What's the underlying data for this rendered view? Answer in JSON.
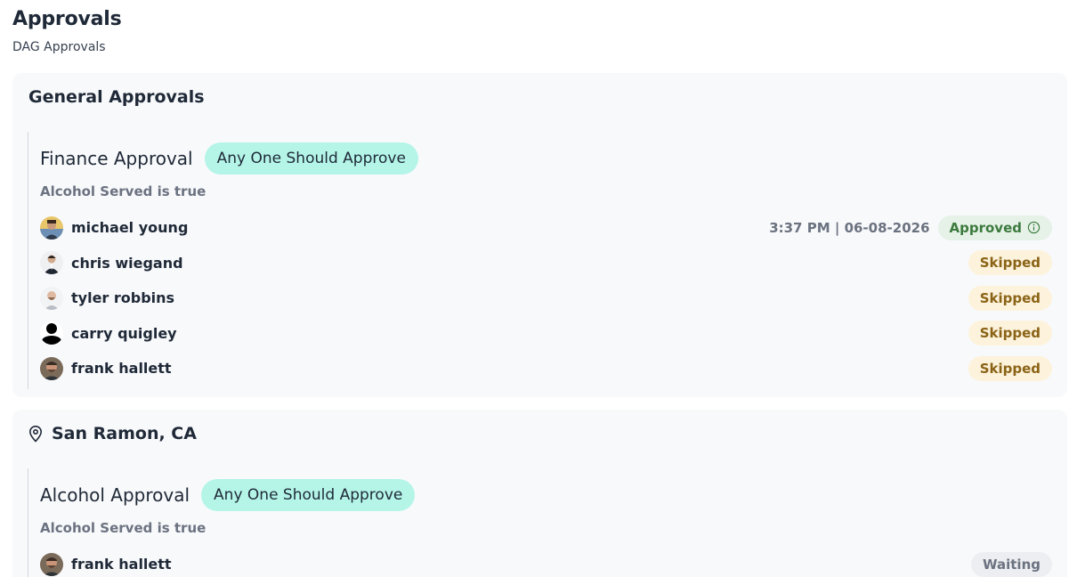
{
  "page": {
    "title": "Approvals",
    "subtitle": "DAG Approvals"
  },
  "sections": [
    {
      "title": "General Approvals",
      "icon": null,
      "groups": [
        {
          "title": "Finance Approval",
          "rule": "Any One Should Approve",
          "condition": "Alcohol Served is true",
          "approvers": [
            {
              "name": "michael young",
              "timestamp": "3:37 PM | 06-08-2026",
              "status": "Approved",
              "status_icon": "info-icon",
              "avatar": "photo-avatar"
            },
            {
              "name": "chris wiegand",
              "timestamp": "",
              "status": "Skipped",
              "avatar": "photo-avatar"
            },
            {
              "name": "tyler robbins",
              "timestamp": "",
              "status": "Skipped",
              "avatar": "photo-avatar"
            },
            {
              "name": "carry quigley",
              "timestamp": "",
              "status": "Skipped",
              "avatar": "default-silhouette-avatar"
            },
            {
              "name": "frank hallett",
              "timestamp": "",
              "status": "Skipped",
              "avatar": "photo-avatar"
            }
          ]
        }
      ]
    },
    {
      "title": "San Ramon, CA",
      "icon": "location-pin-icon",
      "groups": [
        {
          "title": "Alcohol Approval",
          "rule": "Any One Should Approve",
          "condition": "Alcohol Served is true",
          "approvers": [
            {
              "name": "frank hallett",
              "timestamp": "",
              "status": "Waiting",
              "avatar": "photo-avatar"
            }
          ]
        }
      ]
    }
  ],
  "colors": {
    "rule_pill_bg": "#b4f5e8",
    "approved_bg": "#e6f2e8",
    "approved_text": "#3c7a3e",
    "skipped_bg": "#fdf3dc",
    "skipped_text": "#8a6316",
    "waiting_bg": "#eceef1",
    "waiting_text": "#6b7280",
    "section_bg": "#f8f9fb"
  }
}
